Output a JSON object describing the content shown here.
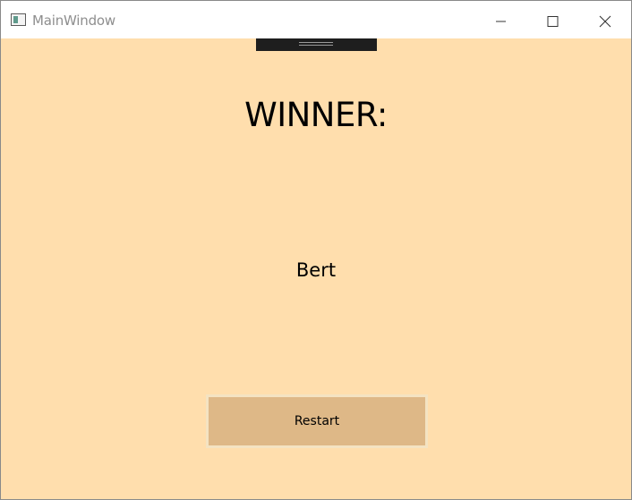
{
  "window": {
    "title": "MainWindow",
    "colors": {
      "background": "#ffdead",
      "titlebar": "#ffffff",
      "button": "#deb887",
      "button_border": "#f4e3c2",
      "debug_bar": "#1e1e1e"
    }
  },
  "titlebar": {
    "app_icon": "window-app-icon",
    "controls": [
      "minimize-icon",
      "maximize-icon",
      "close-icon"
    ]
  },
  "main": {
    "heading": "WINNER:",
    "winner_name": "Bert",
    "restart_label": "Restart"
  }
}
